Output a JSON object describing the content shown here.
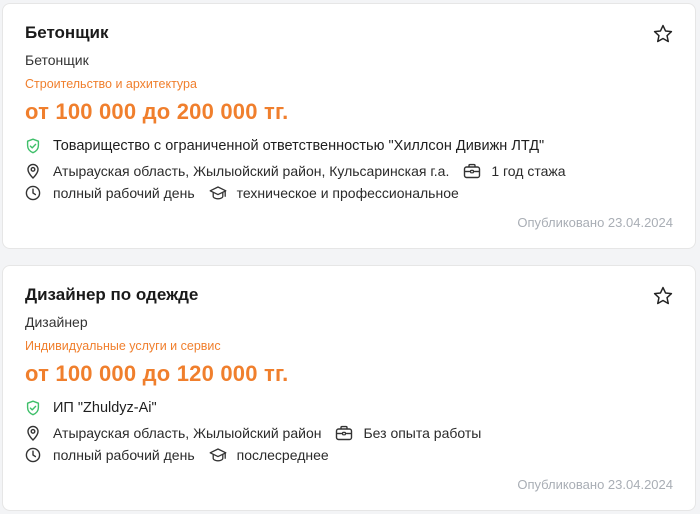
{
  "vacancies": [
    {
      "title": "Бетонщик",
      "profession": "Бетонщик",
      "category": "Строительство и архитектура",
      "salary": "от 100 000 до 200 000 тг.",
      "company": "Товарищество с ограниченной ответственностью \"Хиллсон Дивижн ЛТД\"",
      "location": "Атырауская область, Жылыойский район, Кульсаринская г.а.",
      "experience": "1 год стажа",
      "schedule": "полный рабочий день",
      "education": "техническое и профессиональное",
      "published": "Опубликовано 23.04.2024"
    },
    {
      "title": "Дизайнер по одежде",
      "profession": "Дизайнер",
      "category": "Индивидуальные услуги и сервис",
      "salary": "от 100 000 до 120 000 тг.",
      "company": "ИП \"Zhuldyz-Ai\"",
      "location": "Атырауская область, Жылыойский район",
      "experience": "Без опыта работы",
      "schedule": "полный рабочий день",
      "education": "послесреднее",
      "published": "Опубликовано 23.04.2024"
    }
  ],
  "icons": {
    "favorite": "star-outline-icon",
    "company": "shield-check-icon",
    "location": "map-pin-icon",
    "experience": "briefcase-icon",
    "schedule": "clock-icon",
    "education": "graduation-cap-icon"
  },
  "colors": {
    "accent": "#f07f2d",
    "verified": "#3fbf6a",
    "muted": "#a9aeb5"
  }
}
